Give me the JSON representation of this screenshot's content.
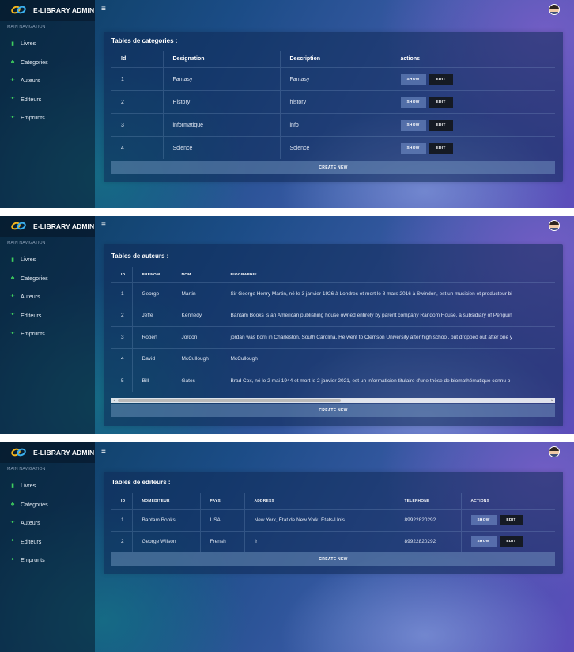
{
  "app": {
    "brand": "E-LIBRARY ADMIN",
    "nav_heading": "MAIN NAVIGATION"
  },
  "sidebar": {
    "items": [
      {
        "label": "Livres",
        "icon": "book-icon"
      },
      {
        "label": "Categories",
        "icon": "sitemap-icon"
      },
      {
        "label": "Auteurs",
        "icon": "users-icon"
      },
      {
        "label": "Editeurs",
        "icon": "users-icon"
      },
      {
        "label": "Emprunts",
        "icon": "users-icon"
      }
    ]
  },
  "colors": {
    "accent_green": "#3fcf5e",
    "edit_button": "#151a24"
  },
  "categories": {
    "title": "Tables de categories :",
    "columns": [
      "Id",
      "Designation",
      "Description",
      "actions"
    ],
    "rows": [
      {
        "id": "1",
        "designation": "Fantasy",
        "description": "Fantasy"
      },
      {
        "id": "2",
        "designation": "History",
        "description": "history"
      },
      {
        "id": "3",
        "designation": "informatique",
        "description": "info"
      },
      {
        "id": "4",
        "designation": "Science",
        "description": "Science"
      }
    ],
    "show_label": "SHOW",
    "edit_label": "EDIT",
    "create_label": "CREATE NEW"
  },
  "auteurs": {
    "title": "Tables de auteurs :",
    "columns": [
      "ID",
      "PRENOM",
      "NOM",
      "BIOGRAPHIE"
    ],
    "rows": [
      {
        "id": "1",
        "prenom": "George",
        "nom": "Martin",
        "bio": "Sir George Henry Martin, né le 3 janvier 1926 à Londres et mort le 8 mars 2016 à Swindon, est un musicien et producteur bi"
      },
      {
        "id": "2",
        "prenom": "Jeffe",
        "nom": "Kennedy",
        "bio": "Bantam Books is an American publishing house owned entirely by parent company Random House, a subsidiary of Penguin"
      },
      {
        "id": "3",
        "prenom": "Robert",
        "nom": "Jordon",
        "bio": "jordan was born in Charleston, South Carolina. He went to Clemson University after high school, but dropped out after one y"
      },
      {
        "id": "4",
        "prenom": "David",
        "nom": "McCullough",
        "bio": "McCullough"
      },
      {
        "id": "5",
        "prenom": "Bill",
        "nom": "Gates",
        "bio": "Brad Cox, né le 2 mai 1944 et mort le 2 janvier 2021, est un informaticien titulaire d'une thèse de biomathématique connu p"
      }
    ],
    "create_label": "CREATE NEW"
  },
  "editeurs": {
    "title": "Tables de editeurs :",
    "columns": [
      "ID",
      "NOMEDITEUR",
      "PAYS",
      "ADDRESS",
      "TELEPHONE",
      "ACTIONS"
    ],
    "rows": [
      {
        "id": "1",
        "nom": "Bantam Books",
        "pays": "USA",
        "address": "New York, État de New York, États-Unis",
        "telephone": "89922820292"
      },
      {
        "id": "2",
        "nom": "George Wilson",
        "pays": "Frensh",
        "address": "fr",
        "telephone": "89922820292"
      }
    ],
    "show_label": "SHOW",
    "edit_label": "EDIT",
    "create_label": "CREATE NEW"
  }
}
